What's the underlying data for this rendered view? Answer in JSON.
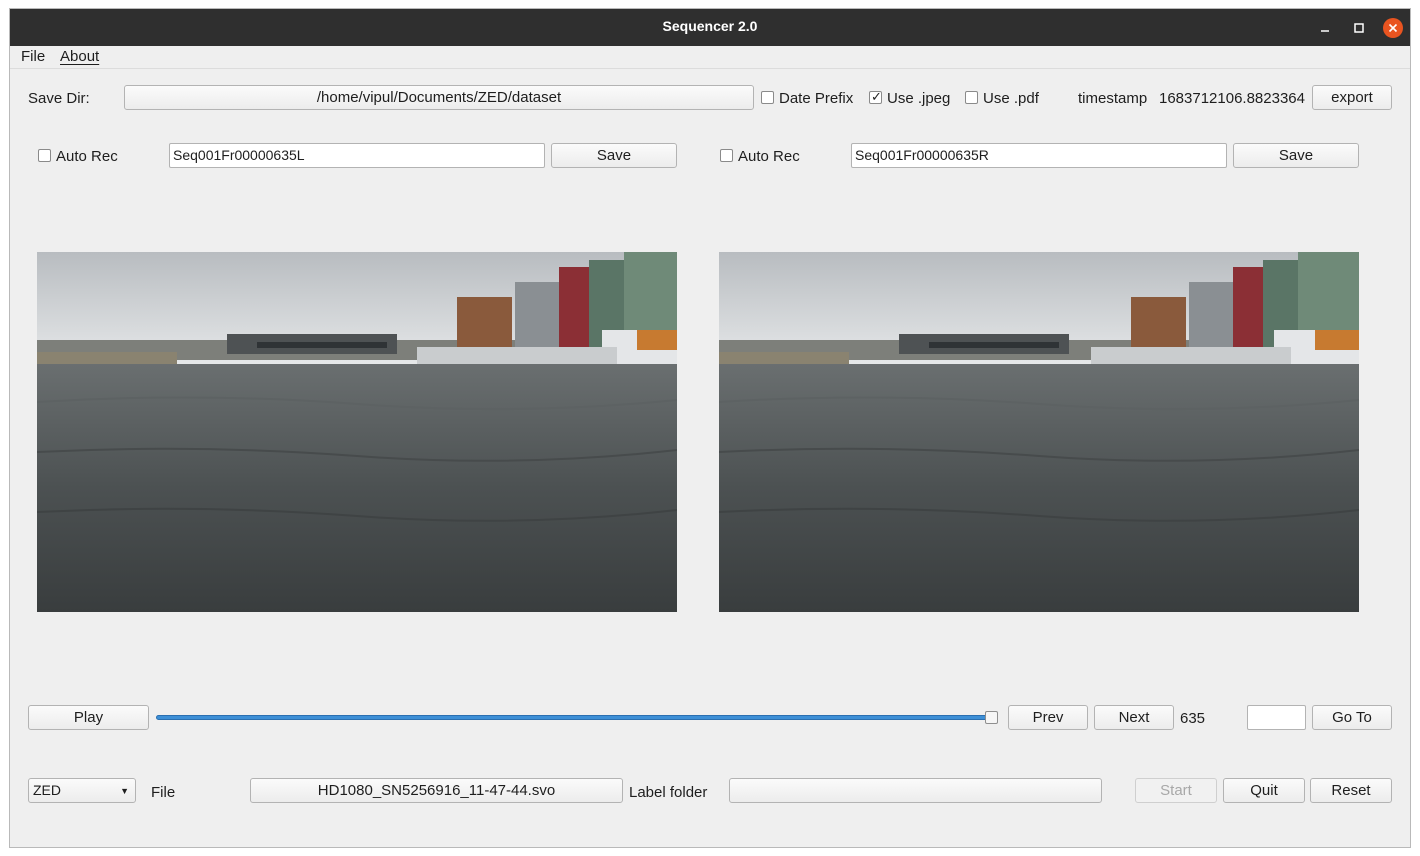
{
  "window": {
    "title": "Sequencer 2.0"
  },
  "menu": {
    "file": "File",
    "about": "About"
  },
  "save_dir": {
    "label": "Save Dir:",
    "path": "/home/vipul/Documents/ZED/dataset",
    "date_prefix": {
      "label": "Date Prefix",
      "checked": false
    },
    "use_jpeg": {
      "label": "Use .jpeg",
      "checked": true
    },
    "use_pdf": {
      "label": "Use .pdf",
      "checked": false
    },
    "timestamp_label": "timestamp",
    "timestamp_value": "1683712106.8823364",
    "export_label": "export"
  },
  "left": {
    "auto_rec_label": "Auto Rec",
    "auto_rec_checked": false,
    "filename": "Seq001Fr00000635L",
    "save_label": "Save"
  },
  "right": {
    "auto_rec_label": "Auto Rec",
    "auto_rec_checked": false,
    "filename": "Seq001Fr00000635R",
    "save_label": "Save"
  },
  "playback": {
    "play_label": "Play",
    "slider_fraction": 0.997,
    "prev_label": "Prev",
    "next_label": "Next",
    "frame_number": "635",
    "goto_value": "",
    "goto_label": "Go To"
  },
  "bottom": {
    "source_selected": "ZED",
    "file_label": "File",
    "file_value": "HD1080_SN5256916_11-47-44.svo",
    "label_folder_label": "Label folder",
    "label_folder_value": "",
    "start_label": "Start",
    "quit_label": "Quit",
    "reset_label": "Reset"
  },
  "colors": {
    "titlebar": "#2f2f2f",
    "close": "#e95420",
    "slider": "#3d8fd6",
    "window_bg": "#efefef"
  }
}
